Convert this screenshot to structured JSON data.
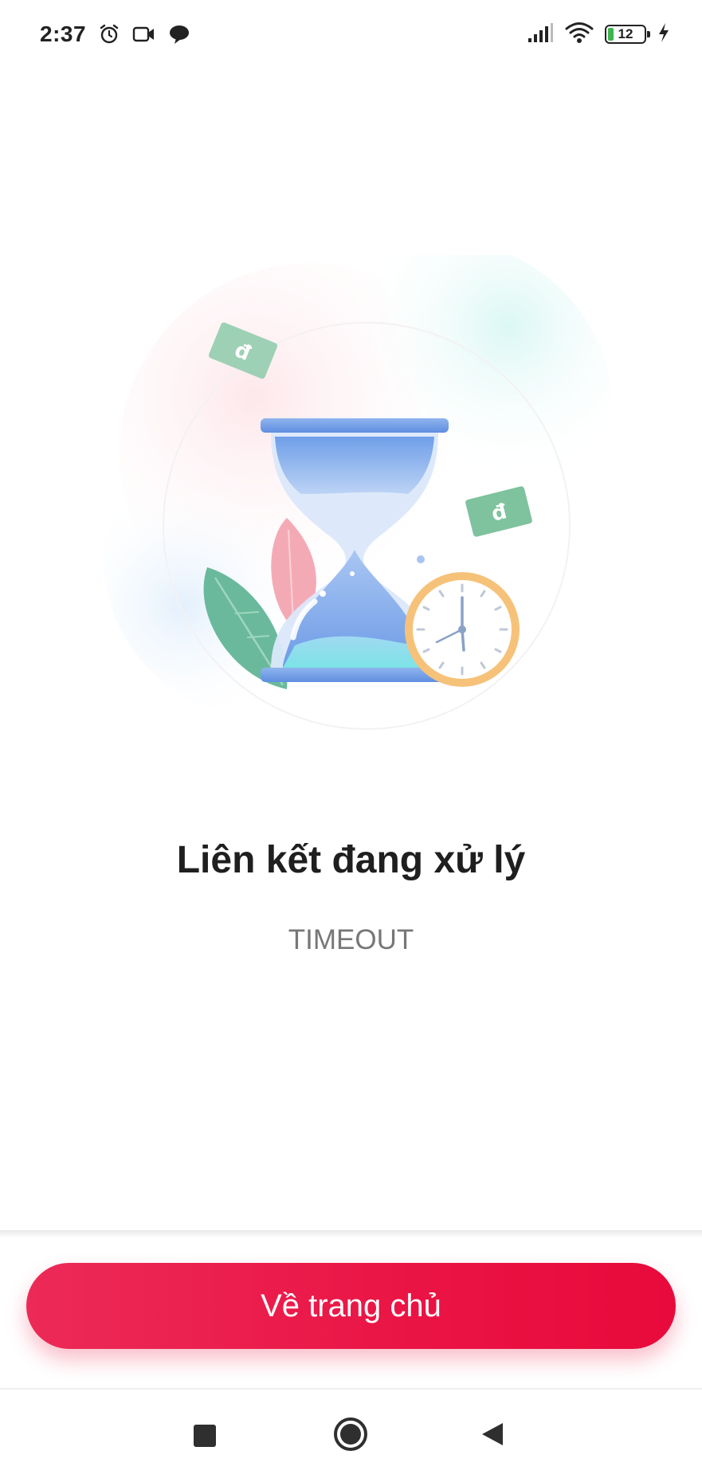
{
  "status_bar": {
    "time": "2:37",
    "battery_level": "12",
    "icons_left": [
      "alarm-icon",
      "video-camera-icon",
      "chat-bubble-icon"
    ],
    "icons_right": [
      "signal-icon",
      "wifi-icon",
      "battery-icon",
      "charging-icon"
    ]
  },
  "illustration": {
    "description_icons": [
      "hourglass-icon",
      "clock-icon",
      "money-note-icon",
      "leaf-icon"
    ],
    "note_symbol": "đ"
  },
  "main": {
    "title": "Liên kết đang xử lý",
    "status_code": "TIMEOUT"
  },
  "actions": {
    "home_button_label": "Về trang chủ"
  },
  "nav_bar": {
    "buttons": [
      "recent-apps",
      "home",
      "back"
    ]
  },
  "colors": {
    "primary": "#EA1444",
    "title": "#1F1F1F",
    "subtitle": "#777777"
  }
}
